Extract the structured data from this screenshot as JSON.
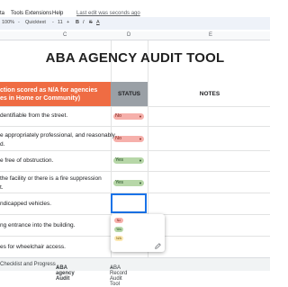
{
  "menubar": {
    "items": [
      "ta",
      "Tools",
      "Extensions",
      "Help"
    ],
    "last_edit": "Last edit was seconds ago"
  },
  "toolbar": {
    "zoom": "100%",
    "items": [
      "-",
      "Quicktext",
      "-",
      "11",
      "+",
      "B",
      "I",
      "S",
      "A"
    ]
  },
  "columns": [
    "C",
    "D",
    "E"
  ],
  "title": "ABA AGENCY AUDIT TOOL",
  "table_header": {
    "left_line1": "ction scored as N/A for agencies",
    "left_line2": "es in Home or Community)",
    "status": "STATUS",
    "notes": "NOTES"
  },
  "rows": [
    {
      "text": "dentifiable from the street.",
      "status": "No"
    },
    {
      "text1": "e appropriately professional, and reasonably",
      "text2": "d.",
      "status": "No"
    },
    {
      "text": "e free of obstruction.",
      "status": "Yes"
    },
    {
      "text1": "the facility or there is a fire suppression",
      "text2": "t.",
      "status": "Yes"
    },
    {
      "text": "ndicapped vehicles.",
      "status": ""
    },
    {
      "text": "ng entrance into the building.",
      "status": ""
    },
    {
      "text": "es for wheelchair access.",
      "status": ""
    }
  ],
  "dropdown": {
    "options": [
      "No",
      "Yes",
      "N/A"
    ],
    "edit_icon": "pencil-icon"
  },
  "sheet_tabs": [
    "Checklist and Progress",
    "ABA agency Audit",
    "ABA Record Audit Tool"
  ],
  "colors": {
    "header_orange": "#ef6c43",
    "status_gray": "#9aa0a6",
    "chip_no": "#f6b0ab",
    "chip_yes": "#b7d7a8",
    "active_tab": "#188038",
    "selection": "#1a73e8"
  }
}
